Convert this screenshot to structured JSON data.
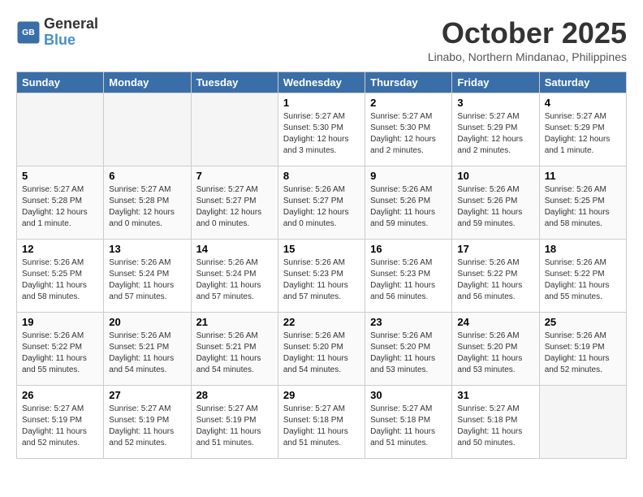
{
  "header": {
    "logo_line1": "General",
    "logo_line2": "Blue",
    "month": "October 2025",
    "location": "Linabo, Northern Mindanao, Philippines"
  },
  "weekdays": [
    "Sunday",
    "Monday",
    "Tuesday",
    "Wednesday",
    "Thursday",
    "Friday",
    "Saturday"
  ],
  "weeks": [
    [
      {
        "day": "",
        "empty": true
      },
      {
        "day": "",
        "empty": true
      },
      {
        "day": "",
        "empty": true
      },
      {
        "day": "1",
        "sunrise": "5:27 AM",
        "sunset": "5:30 PM",
        "daylight": "12 hours and 3 minutes."
      },
      {
        "day": "2",
        "sunrise": "5:27 AM",
        "sunset": "5:30 PM",
        "daylight": "12 hours and 2 minutes."
      },
      {
        "day": "3",
        "sunrise": "5:27 AM",
        "sunset": "5:29 PM",
        "daylight": "12 hours and 2 minutes."
      },
      {
        "day": "4",
        "sunrise": "5:27 AM",
        "sunset": "5:29 PM",
        "daylight": "12 hours and 1 minute."
      }
    ],
    [
      {
        "day": "5",
        "sunrise": "5:27 AM",
        "sunset": "5:28 PM",
        "daylight": "12 hours and 1 minute."
      },
      {
        "day": "6",
        "sunrise": "5:27 AM",
        "sunset": "5:28 PM",
        "daylight": "12 hours and 0 minutes."
      },
      {
        "day": "7",
        "sunrise": "5:27 AM",
        "sunset": "5:27 PM",
        "daylight": "12 hours and 0 minutes."
      },
      {
        "day": "8",
        "sunrise": "5:26 AM",
        "sunset": "5:27 PM",
        "daylight": "12 hours and 0 minutes."
      },
      {
        "day": "9",
        "sunrise": "5:26 AM",
        "sunset": "5:26 PM",
        "daylight": "11 hours and 59 minutes."
      },
      {
        "day": "10",
        "sunrise": "5:26 AM",
        "sunset": "5:26 PM",
        "daylight": "11 hours and 59 minutes."
      },
      {
        "day": "11",
        "sunrise": "5:26 AM",
        "sunset": "5:25 PM",
        "daylight": "11 hours and 58 minutes."
      }
    ],
    [
      {
        "day": "12",
        "sunrise": "5:26 AM",
        "sunset": "5:25 PM",
        "daylight": "11 hours and 58 minutes."
      },
      {
        "day": "13",
        "sunrise": "5:26 AM",
        "sunset": "5:24 PM",
        "daylight": "11 hours and 57 minutes."
      },
      {
        "day": "14",
        "sunrise": "5:26 AM",
        "sunset": "5:24 PM",
        "daylight": "11 hours and 57 minutes."
      },
      {
        "day": "15",
        "sunrise": "5:26 AM",
        "sunset": "5:23 PM",
        "daylight": "11 hours and 57 minutes."
      },
      {
        "day": "16",
        "sunrise": "5:26 AM",
        "sunset": "5:23 PM",
        "daylight": "11 hours and 56 minutes."
      },
      {
        "day": "17",
        "sunrise": "5:26 AM",
        "sunset": "5:22 PM",
        "daylight": "11 hours and 56 minutes."
      },
      {
        "day": "18",
        "sunrise": "5:26 AM",
        "sunset": "5:22 PM",
        "daylight": "11 hours and 55 minutes."
      }
    ],
    [
      {
        "day": "19",
        "sunrise": "5:26 AM",
        "sunset": "5:22 PM",
        "daylight": "11 hours and 55 minutes."
      },
      {
        "day": "20",
        "sunrise": "5:26 AM",
        "sunset": "5:21 PM",
        "daylight": "11 hours and 54 minutes."
      },
      {
        "day": "21",
        "sunrise": "5:26 AM",
        "sunset": "5:21 PM",
        "daylight": "11 hours and 54 minutes."
      },
      {
        "day": "22",
        "sunrise": "5:26 AM",
        "sunset": "5:20 PM",
        "daylight": "11 hours and 54 minutes."
      },
      {
        "day": "23",
        "sunrise": "5:26 AM",
        "sunset": "5:20 PM",
        "daylight": "11 hours and 53 minutes."
      },
      {
        "day": "24",
        "sunrise": "5:26 AM",
        "sunset": "5:20 PM",
        "daylight": "11 hours and 53 minutes."
      },
      {
        "day": "25",
        "sunrise": "5:26 AM",
        "sunset": "5:19 PM",
        "daylight": "11 hours and 52 minutes."
      }
    ],
    [
      {
        "day": "26",
        "sunrise": "5:27 AM",
        "sunset": "5:19 PM",
        "daylight": "11 hours and 52 minutes."
      },
      {
        "day": "27",
        "sunrise": "5:27 AM",
        "sunset": "5:19 PM",
        "daylight": "11 hours and 52 minutes."
      },
      {
        "day": "28",
        "sunrise": "5:27 AM",
        "sunset": "5:19 PM",
        "daylight": "11 hours and 51 minutes."
      },
      {
        "day": "29",
        "sunrise": "5:27 AM",
        "sunset": "5:18 PM",
        "daylight": "11 hours and 51 minutes."
      },
      {
        "day": "30",
        "sunrise": "5:27 AM",
        "sunset": "5:18 PM",
        "daylight": "11 hours and 51 minutes."
      },
      {
        "day": "31",
        "sunrise": "5:27 AM",
        "sunset": "5:18 PM",
        "daylight": "11 hours and 50 minutes."
      },
      {
        "day": "",
        "empty": true
      }
    ]
  ]
}
